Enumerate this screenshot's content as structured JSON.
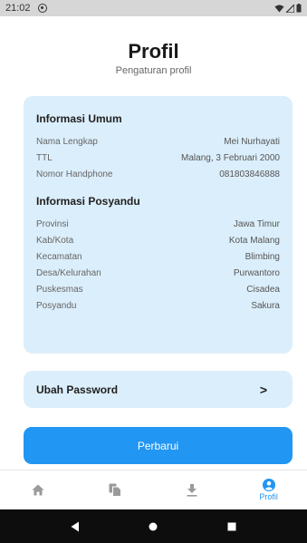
{
  "status_bar": {
    "time": "21:02"
  },
  "header": {
    "title": "Profil",
    "subtitle": "Pengaturan profil"
  },
  "general_info": {
    "title": "Informasi Umum",
    "rows": [
      {
        "label": "Nama Lengkap",
        "value": "Mei Nurhayati"
      },
      {
        "label": "TTL",
        "value": "Malang, 3 Februari 2000"
      },
      {
        "label": "Nomor Handphone",
        "value": "081803846888"
      }
    ]
  },
  "posyandu_info": {
    "title": "Informasi Posyandu",
    "rows": [
      {
        "label": "Provinsi",
        "value": "Jawa Timur"
      },
      {
        "label": "Kab/Kota",
        "value": "Kota Malang"
      },
      {
        "label": "Kecamatan",
        "value": "Blimbing"
      },
      {
        "label": "Desa/Kelurahan",
        "value": "Purwantoro"
      },
      {
        "label": "Puskesmas",
        "value": "Cisadea"
      },
      {
        "label": "Posyandu",
        "value": "Sakura"
      }
    ]
  },
  "password": {
    "label": "Ubah Password",
    "chevron": ">"
  },
  "update_button": {
    "label": "Perbarui"
  },
  "bottom_nav": {
    "items": [
      {
        "icon": "home-icon",
        "label": ""
      },
      {
        "icon": "documents-icon",
        "label": ""
      },
      {
        "icon": "download-icon",
        "label": ""
      },
      {
        "icon": "profile-icon",
        "label": "Profil",
        "active": true
      }
    ]
  },
  "colors": {
    "accent": "#2196f3",
    "card_bg": "#dbeefb",
    "icon_inactive": "#9a9a9a"
  }
}
